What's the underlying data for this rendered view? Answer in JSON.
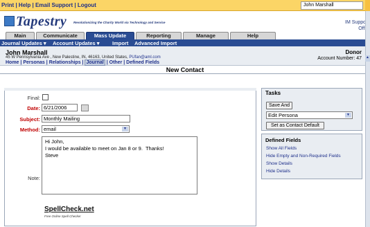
{
  "topbar": {
    "links": [
      "Print",
      "Help",
      "Email Support",
      "Logout"
    ],
    "user_value": "John Marshall"
  },
  "header": {
    "logo": "Tapestry",
    "tagline": "Revolutionizing the Charity World via Technology and Service",
    "right_line1": "IM Suppo",
    "right_line2": "Offi"
  },
  "tabs": [
    {
      "label": "Main"
    },
    {
      "label": "Communicate"
    },
    {
      "label": "Mass Update"
    },
    {
      "label": "Reporting"
    },
    {
      "label": "Manage"
    },
    {
      "label": "Help"
    }
  ],
  "subnav": [
    "Journal Updates ▾",
    "Account Updates ▾",
    "Import",
    "Advanced Import"
  ],
  "contact": {
    "name": "John Marshall",
    "address": "45 W Pennsylvania Ave , New Palestine, IN, 46163, United States,",
    "email": "PUfan@aml.com",
    "links": [
      "Home",
      "Personas",
      "Relationships",
      "Journal",
      "Other",
      "Defined Fields"
    ],
    "type": "Donor",
    "account": "Account Number: 47"
  },
  "page_title": "New Contact",
  "form": {
    "final_label": "Final:",
    "date_label": "Date:",
    "date_value": "6/21/2006",
    "subject_label": "Subject:",
    "subject_value": "Monthly Mailing",
    "method_label": "Method:",
    "method_value": "email",
    "note_label": "Note:",
    "note_lines": [
      "Hi John,",
      "",
      "I would be available to meet on Jan 8 or 9.  Thanks!",
      "",
      "Steve"
    ]
  },
  "spellcheck": {
    "title": "SpellCheck.net",
    "subtitle": "Free Online Spell Checker"
  },
  "tasks": {
    "title": "Tasks",
    "save_label": "Save And",
    "action_value": "Edit Persona",
    "default_label": "Set as Contact Default"
  },
  "defined_fields": {
    "title": "Defined Fields",
    "links": [
      "Show All Fields",
      "Hide Empty and Non-Required Fields",
      "Show Details",
      "Hide Details"
    ]
  }
}
